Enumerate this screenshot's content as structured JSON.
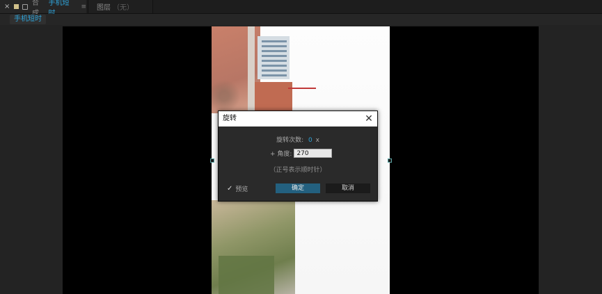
{
  "topbar": {
    "close_glyph": "×",
    "comp_label": "合成",
    "comp_name": "手机短时",
    "menu_glyph": "≡",
    "layer_label": "图层",
    "layer_value": "（无）"
  },
  "crumbs": {
    "item": "手机短时"
  },
  "dialog": {
    "title": "旋转",
    "rotation_count_label": "旋转次数:",
    "rotation_count_value": "0",
    "rotation_count_unit": "x",
    "angle_label": "+ 角度:",
    "angle_value": "270",
    "note": "（正号表示顺时针）",
    "preview_label": "预览",
    "preview_checked": true,
    "ok_label": "确定",
    "cancel_label": "取消"
  },
  "colors": {
    "accent": "#2fa3d9",
    "ok_button": "#23607f"
  }
}
